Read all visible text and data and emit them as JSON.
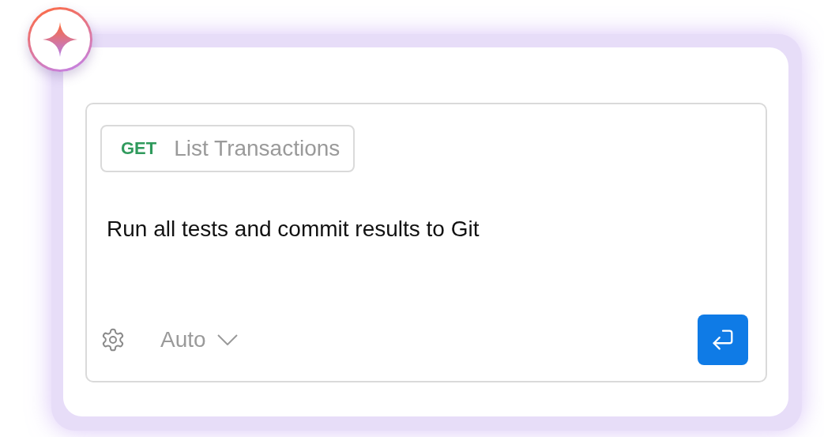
{
  "request": {
    "method": "GET",
    "name": "List Transactions"
  },
  "prompt": {
    "value": "Run all tests and commit results to Git"
  },
  "mode": {
    "label": "Auto"
  }
}
